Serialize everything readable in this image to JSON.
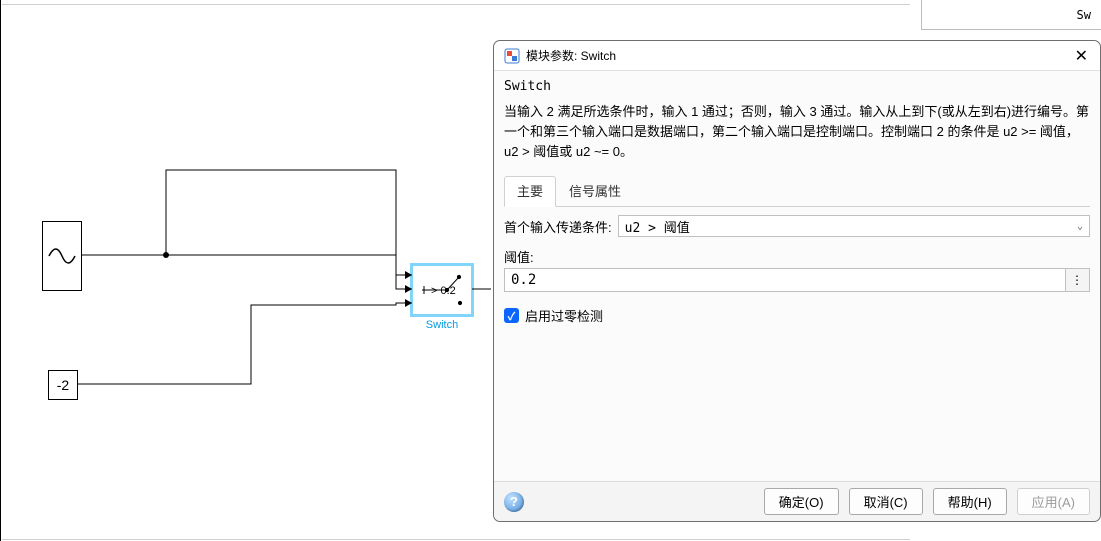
{
  "canvas": {
    "const_value": "-2",
    "switch_threshold_text": "> 0.2",
    "switch_label": "Switch"
  },
  "top_panel": {
    "label_fragment": "Sw"
  },
  "dialog": {
    "titlebar": "模块参数: Switch",
    "block_type": "Switch",
    "description": "当输入 2 满足所选条件时，输入 1 通过；否则，输入 3 通过。输入从上到下(或从左到右)进行编号。第一个和第三个输入端口是数据端口，第二个输入端口是控制端口。控制端口 2 的条件是 u2 >= 阈值，u2 > 阈值或 u2 ~= 0。",
    "tabs": {
      "main": "主要",
      "signal": "信号属性"
    },
    "criteria": {
      "label": "首个输入传递条件:",
      "value": "u2 > 阈值"
    },
    "threshold": {
      "label": "阈值:",
      "value": "0.2"
    },
    "zero_cross": {
      "label": "启用过零检测",
      "checked": true
    },
    "buttons": {
      "ok": "确定(O)",
      "cancel": "取消(C)",
      "help": "帮助(H)",
      "apply": "应用(A)"
    }
  }
}
